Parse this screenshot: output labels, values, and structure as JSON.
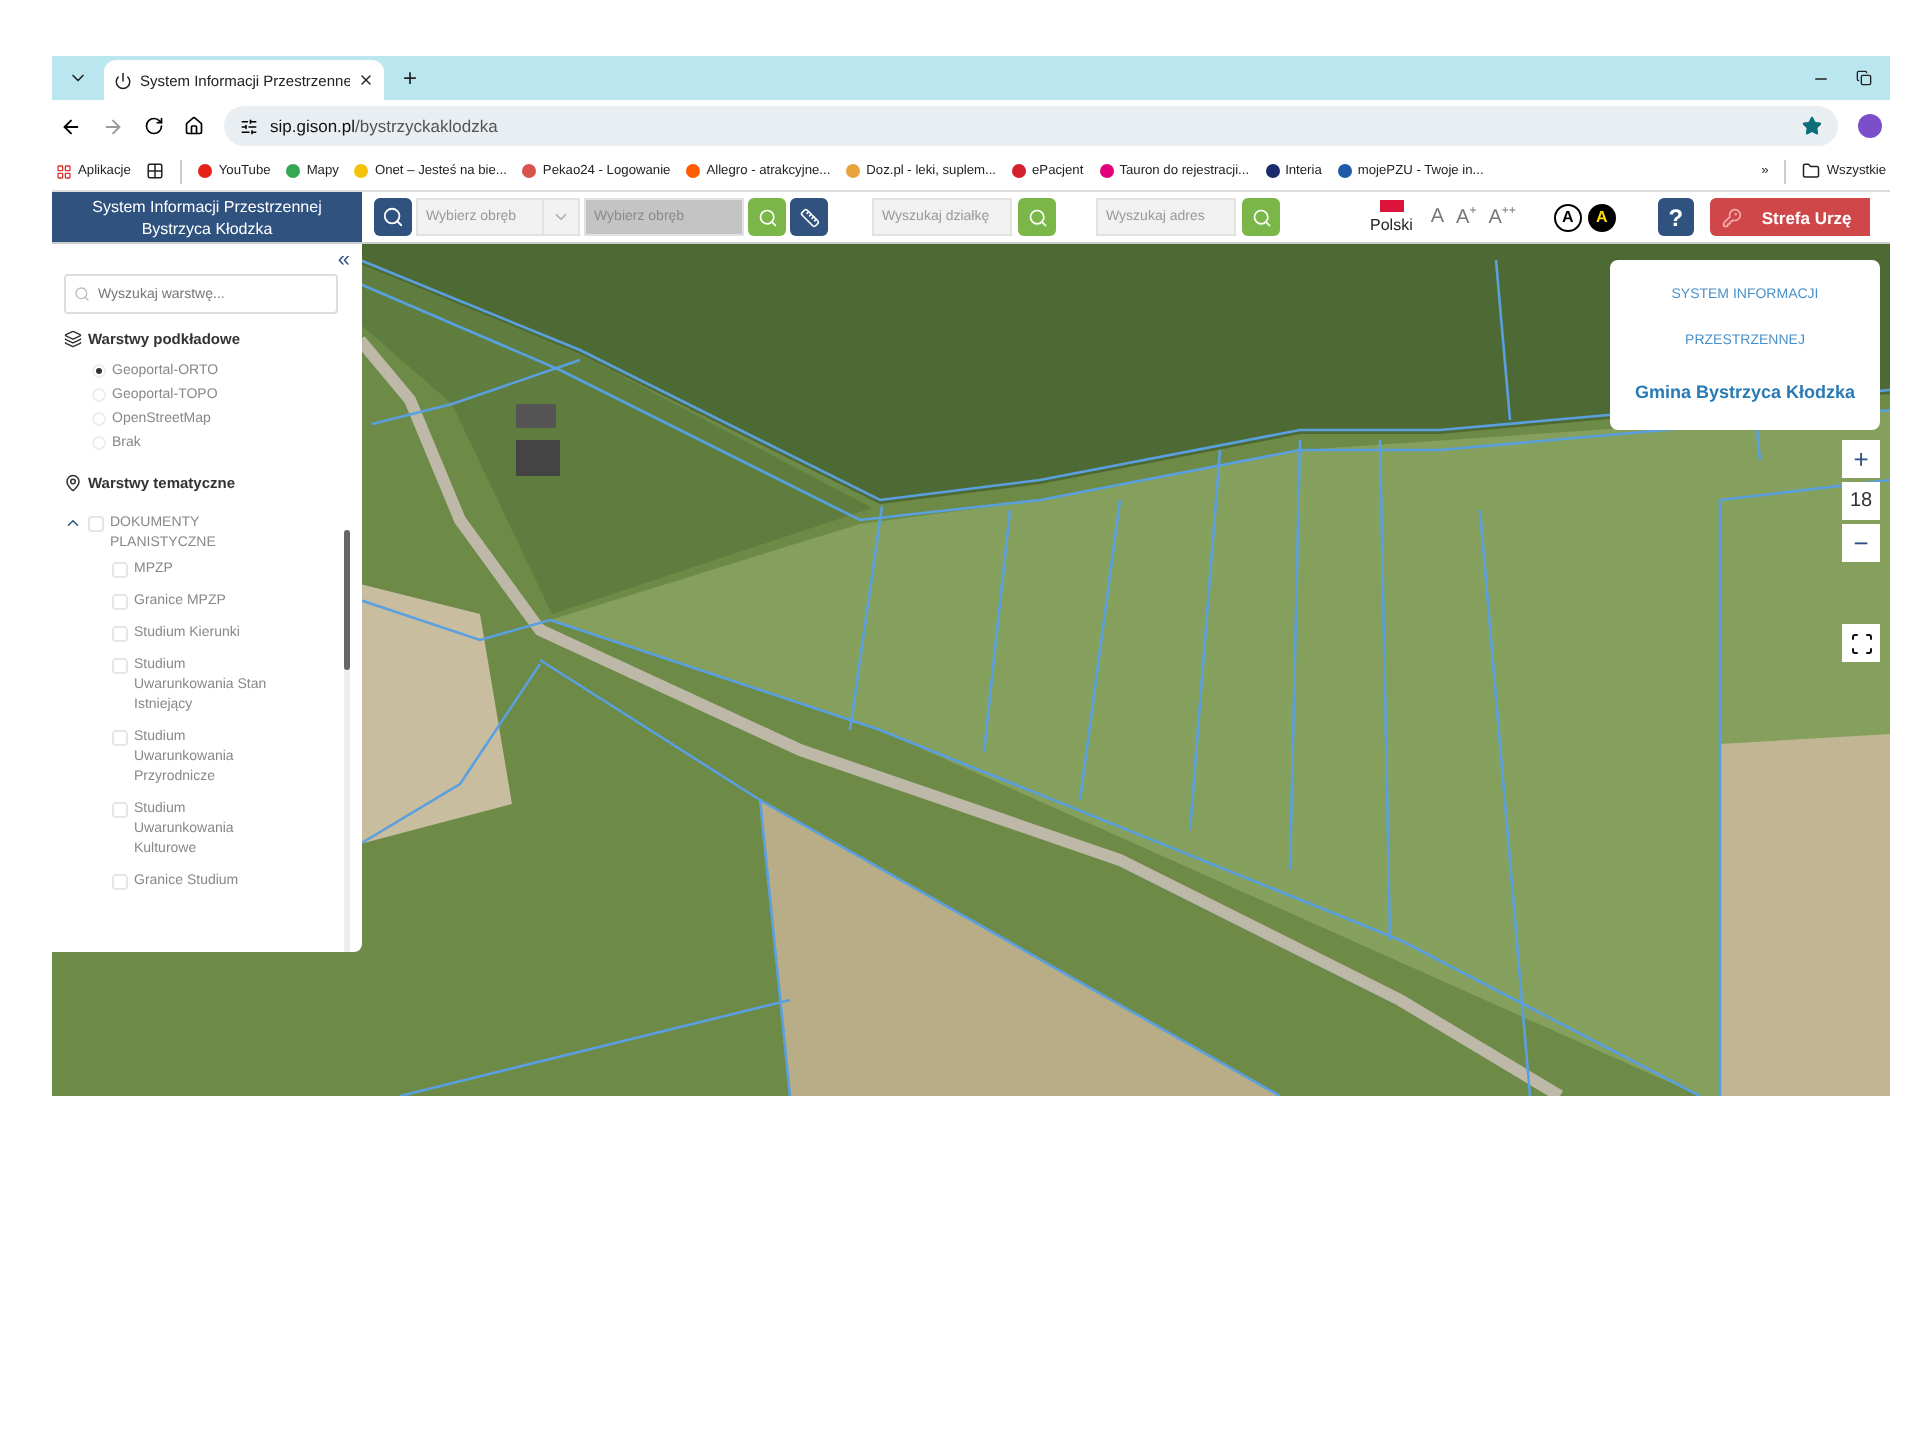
{
  "browser": {
    "tab_title": "System Informacji Przestrzenne",
    "new_tab": "+",
    "url_host": "sip.gison.pl",
    "url_path": "/bystrzyckaklodzka"
  },
  "bookmarks_bar": {
    "apps_label": "Aplikacje",
    "items": [
      {
        "label": "YouTube",
        "color": "#e62117"
      },
      {
        "label": "Mapy",
        "color": "#34a853"
      },
      {
        "label": "Onet – Jesteś na bie...",
        "color": "#f4c20d"
      },
      {
        "label": "Pekao24 - Logowanie",
        "color": "#d9534f"
      },
      {
        "label": "Allegro - atrakcyjne...",
        "color": "#ff5a00"
      },
      {
        "label": "Doz.pl - leki, suplem...",
        "color": "#e8a33d"
      },
      {
        "label": "ePacjent",
        "color": "#d61f2c"
      },
      {
        "label": "Tauron do rejestracji...",
        "color": "#e2007a"
      },
      {
        "label": "Interia",
        "color": "#1a2a6c"
      },
      {
        "label": "mojePZU - Twoje in...",
        "color": "#1e5aa8"
      }
    ],
    "overflow": "»",
    "folder_label": "Wszystkie"
  },
  "header": {
    "title_lines": [
      "System Informacji Przestrzennej",
      "Bystrzyca Kłodzka"
    ],
    "precinct_select": {
      "placeholder": "Wybierz obręb"
    },
    "precinct_field": {
      "placeholder": "Wybierz obręb",
      "disabled": true
    },
    "parcel_search": {
      "placeholder": "Wyszukaj działkę"
    },
    "address_search": {
      "placeholder": "Wyszukaj adres"
    },
    "language": "Polski",
    "font_sizes": [
      "A",
      "A$^{+}$",
      "A$^{++}$"
    ],
    "contrast": [
      {
        "label": "A",
        "kind": "light"
      },
      {
        "label": "A",
        "kind": "dark"
      }
    ],
    "help": "?",
    "zone_button": "Strefa Urzę"
  },
  "sidebar": {
    "collapse": "«",
    "search_placeholder": "Wyszukaj warstwę...",
    "base_layers": {
      "title": "Warstwy podkładowe",
      "items": [
        {
          "label": "Geoportal-ORTO",
          "selected": true
        },
        {
          "label": "Geoportal-TOPO",
          "selected": false
        },
        {
          "label": "OpenStreetMap",
          "selected": false
        },
        {
          "label": "Brak",
          "selected": false
        }
      ]
    },
    "thematic_layers": {
      "title": "Warstwy tematyczne",
      "tree": [
        {
          "label": "DOKUMENTY PLANISTYCZNE",
          "expanded": true,
          "checked": false,
          "children": [
            {
              "label": "MPZP",
              "checked": false
            },
            {
              "label": "Granice MPZP",
              "checked": false
            },
            {
              "label": "Studium Kierunki",
              "checked": false
            },
            {
              "label": "Studium Uwarunkowania Stan Istniejący",
              "checked": false
            },
            {
              "label": "Studium Uwarunkowania Przyrodnicze",
              "checked": false
            },
            {
              "label": "Studium Uwarunkowania Kulturowe",
              "checked": false
            },
            {
              "label": "Granice Studium",
              "checked": false
            }
          ]
        }
      ]
    }
  },
  "map": {
    "info_card": {
      "lines": [
        "SYSTEM INFORMACJI",
        "PRZESTRZENNEJ"
      ],
      "name": "Gmina Bystrzyca Kłodzka"
    },
    "zoom": {
      "in": "+",
      "level": "18",
      "out": "−"
    }
  }
}
